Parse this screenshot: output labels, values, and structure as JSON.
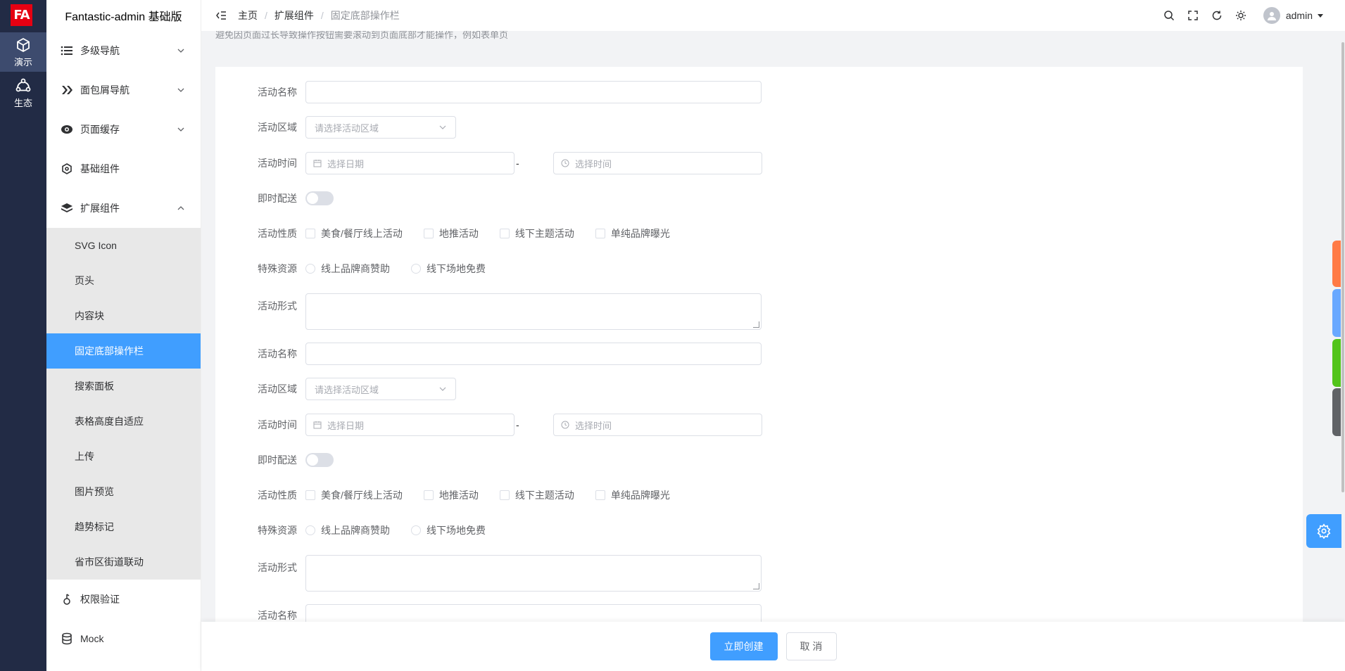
{
  "app": {
    "title": "Fantastic-admin 基础版",
    "logo_text": "FA"
  },
  "main_nav": [
    {
      "label": "演示",
      "icon": "cube-icon",
      "active": true
    },
    {
      "label": "生态",
      "icon": "ecosystem-icon",
      "active": false
    }
  ],
  "sidebar": {
    "items": [
      {
        "label": "多级导航",
        "icon": "list-icon",
        "expanded": false
      },
      {
        "label": "面包屑导航",
        "icon": "breadcrumb-icon",
        "expanded": false
      },
      {
        "label": "页面缓存",
        "icon": "cache-icon",
        "expanded": false
      },
      {
        "label": "基础组件",
        "icon": "component-icon",
        "expanded": null
      },
      {
        "label": "扩展组件",
        "icon": "layers-icon",
        "expanded": true
      }
    ],
    "submenu": [
      {
        "label": "SVG Icon"
      },
      {
        "label": "页头"
      },
      {
        "label": "内容块"
      },
      {
        "label": "固定底部操作栏",
        "active": true
      },
      {
        "label": "搜索面板"
      },
      {
        "label": "表格高度自适应"
      },
      {
        "label": "上传"
      },
      {
        "label": "图片预览"
      },
      {
        "label": "趋势标记"
      },
      {
        "label": "省市区街道联动"
      }
    ],
    "bottom_items": [
      {
        "label": "权限验证",
        "icon": "permission-icon"
      },
      {
        "label": "Mock",
        "icon": "database-icon"
      }
    ]
  },
  "breadcrumb": [
    "主页",
    "扩展组件",
    "固定底部操作栏"
  ],
  "user": {
    "name": "admin"
  },
  "page": {
    "description": "避免因页面过长导致操作按钮需要滚动到页面底部才能操作，例如表单页"
  },
  "form": {
    "name_label": "活动名称",
    "region_label": "活动区域",
    "region_placeholder": "请选择活动区域",
    "time_label": "活动时间",
    "date_placeholder": "选择日期",
    "time_placeholder": "选择时间",
    "range_separator": "-",
    "delivery_label": "即时配送",
    "type_label": "活动性质",
    "type_options": [
      "美食/餐厅线上活动",
      "地推活动",
      "线下主题活动",
      "单纯品牌曝光"
    ],
    "resource_label": "特殊资源",
    "resource_options": [
      "线上品牌商赞助",
      "线下场地免费"
    ],
    "desc_label": "活动形式"
  },
  "actions": {
    "submit": "立即创建",
    "cancel": "取 消"
  },
  "colors": {
    "accent": "#409eff",
    "sidebar_bg": "#222b45",
    "logo_red": "#e60012"
  },
  "theme_tabs": [
    "#ff7a45",
    "#69a8ff",
    "#52c41a",
    "#606266"
  ]
}
